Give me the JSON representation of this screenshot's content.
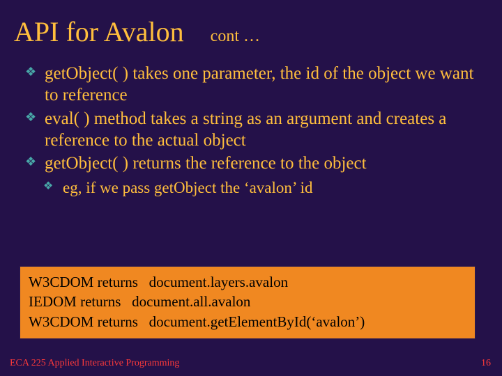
{
  "title": "API for Avalon",
  "subtitle": "cont …",
  "bullets": {
    "b1": "getObject( ) takes one parameter, the id of the object we want to reference",
    "b2": "eval( ) method takes a string as an argument and creates a reference to the actual object",
    "b3": "getObject( ) returns the reference to the object",
    "b3a": "eg, if we pass getObject the ‘avalon’ id"
  },
  "code": {
    "l1": "W3CDOM returns   document.layers.avalon",
    "l2": "IEDOM returns   document.all.avalon",
    "l3": "W3CDOM returns   document.getElementById(‘avalon’)"
  },
  "footer": {
    "left": "ECA 225   Applied Interactive Programming",
    "page": "16"
  }
}
